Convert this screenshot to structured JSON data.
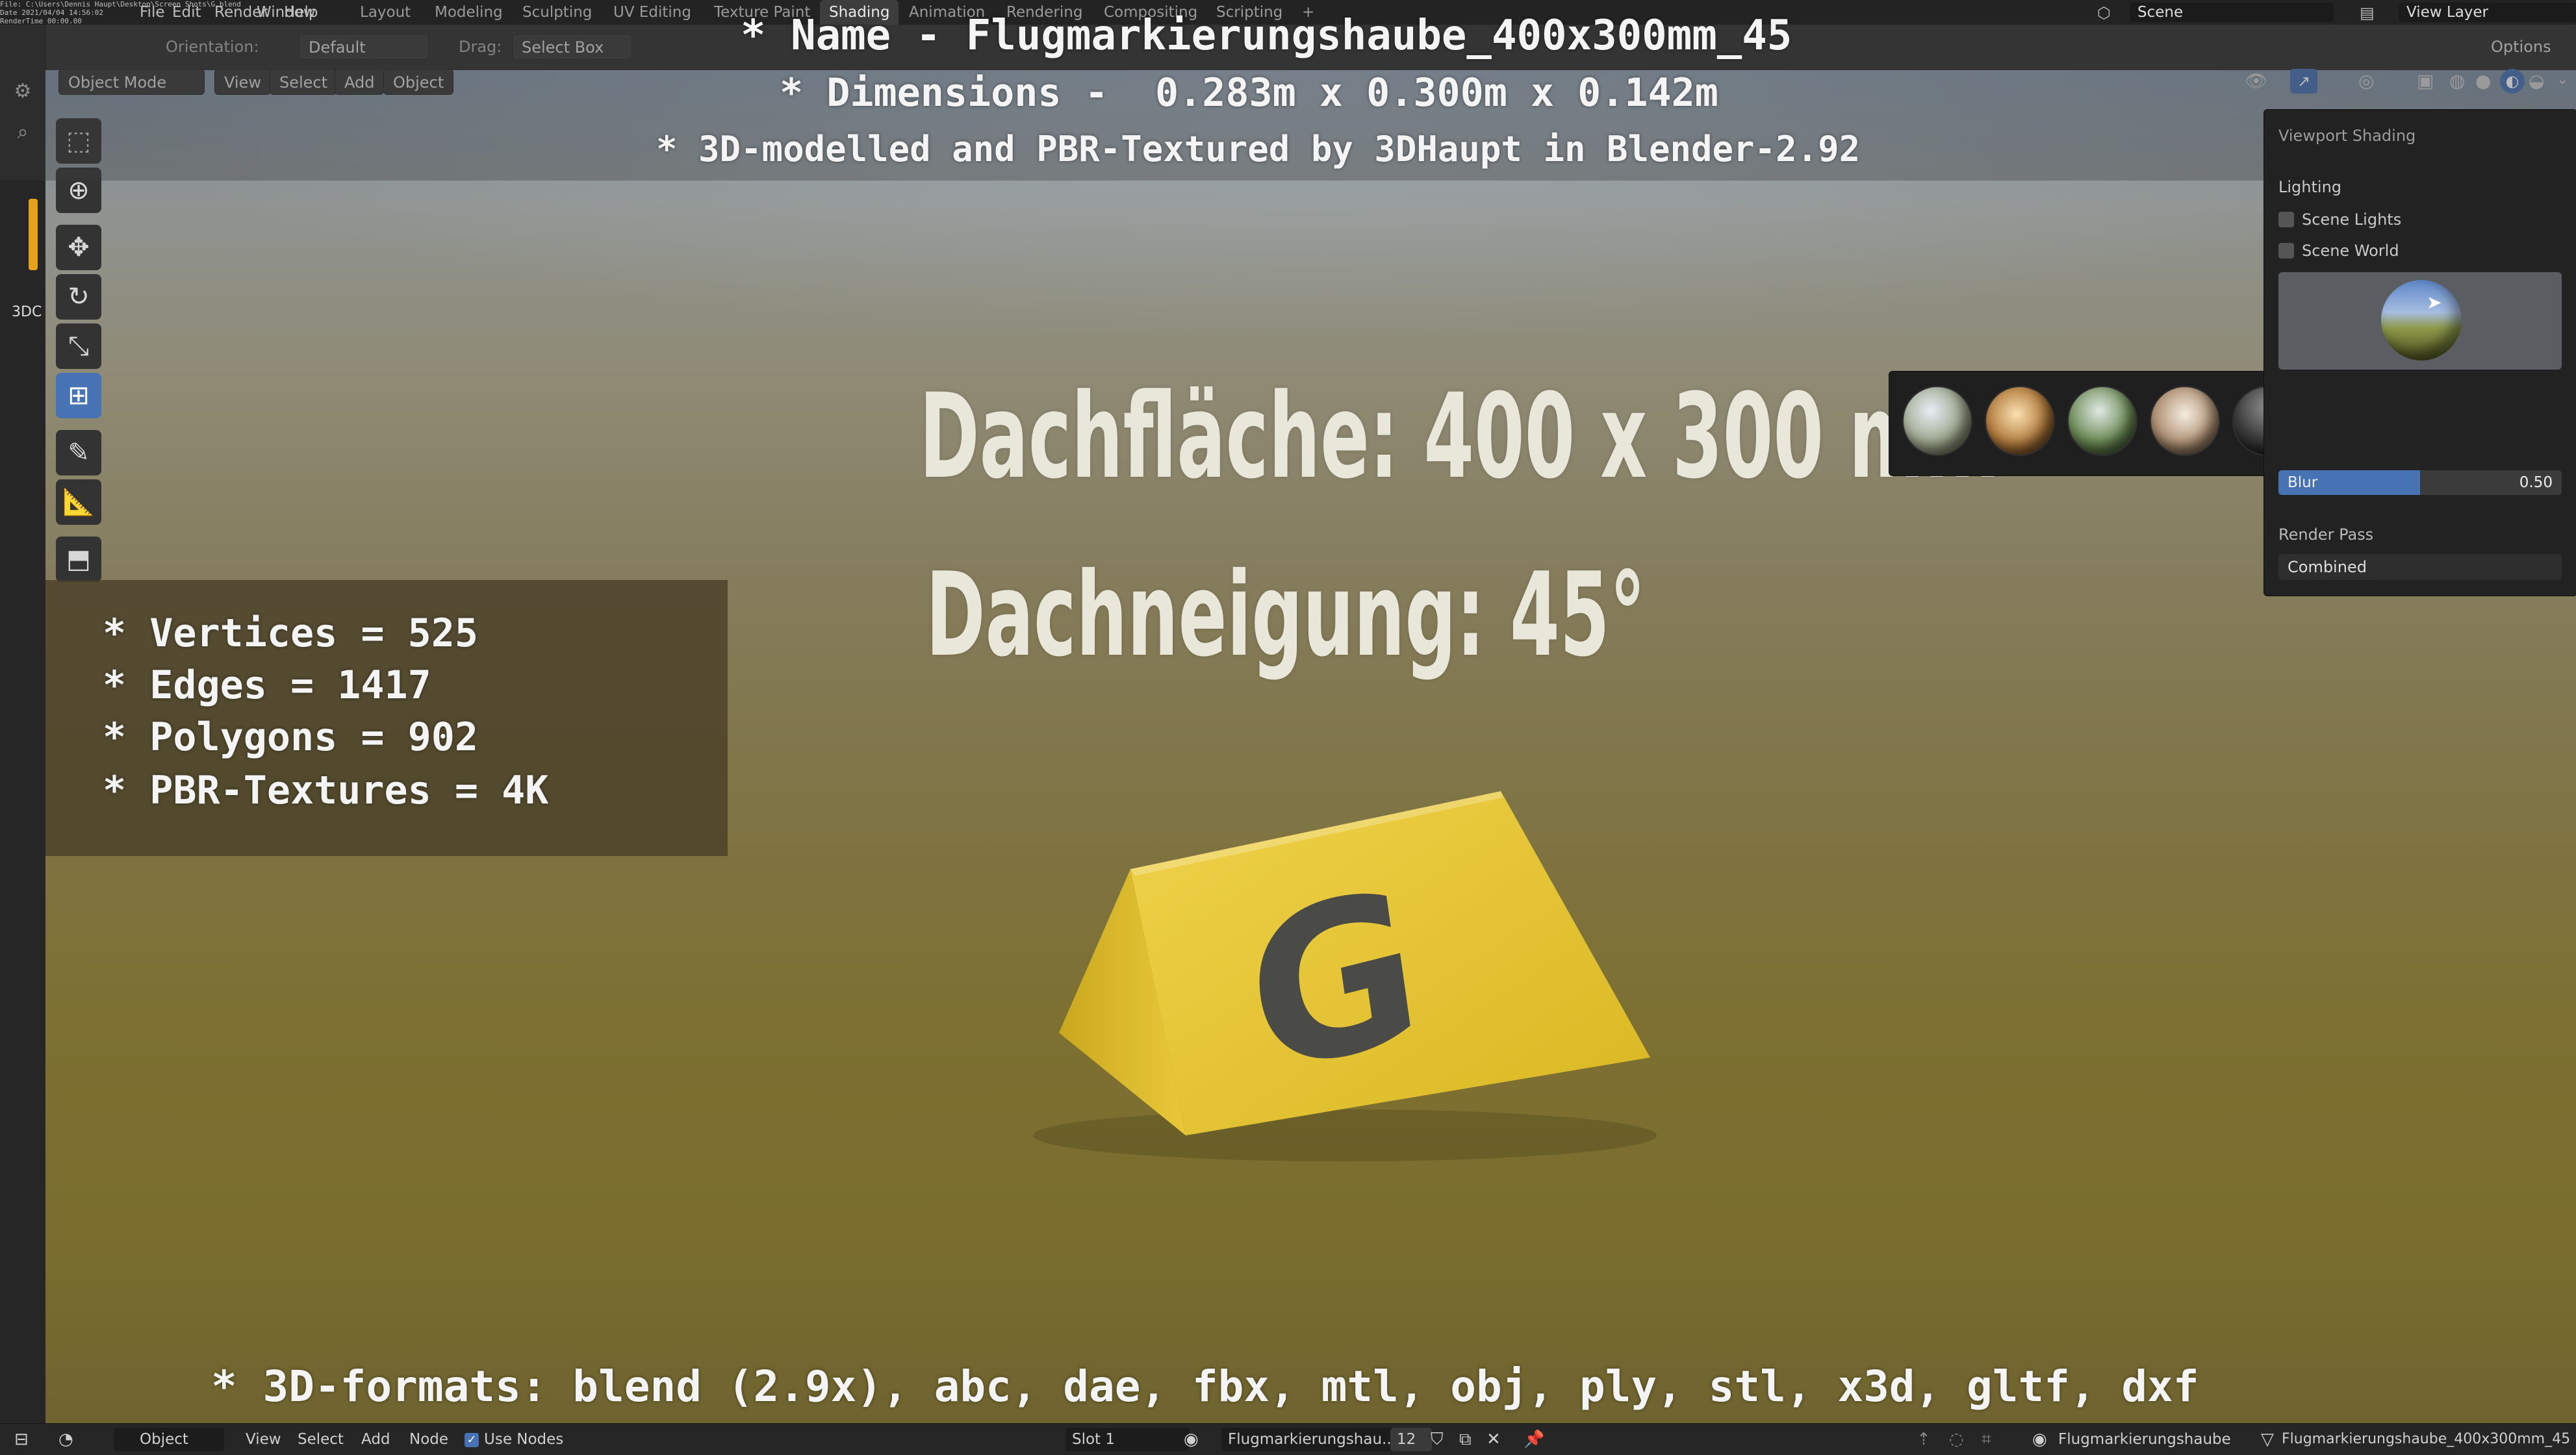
{
  "topbar": {
    "debug_lines": "File: C:\\Users\\Dennis Haupt\\Desktop\\Screen Shots\\G.blend\nDate 2021/04/04 14:56:02\nRenderTime 00:00.00\nModelled and Textured by 3DHaupt in Blender-2.92",
    "menu": [
      "File",
      "Edit",
      "Render",
      "Window",
      "Help"
    ],
    "workspaces": [
      "Layout",
      "Modeling",
      "Sculpting",
      "UV Editing",
      "Texture Paint",
      "Shading",
      "Animation",
      "Rendering",
      "Compositing",
      "Scripting"
    ],
    "active_workspace": "Shading",
    "add_tab": "+",
    "scene": "Scene",
    "view_layer": "View Layer"
  },
  "header": {
    "orientation_label": "Orientation:",
    "orientation_value": "Default",
    "drag_label": "Drag:",
    "drag_value": "Select Box",
    "options": "Options",
    "mode": "Object Mode",
    "menus": [
      "View",
      "Select",
      "Add",
      "Object"
    ]
  },
  "left_strip": {
    "label": "3DC"
  },
  "overlay": {
    "name_line": "* Name - Flugmarkierungshaube_400x300mm_45",
    "dimensions_line": "* Dimensions -  0.283m x 0.300m x 0.142m",
    "credit_line": "* 3D-modelled and PBR-Textured by 3DHaupt in Blender-2.92",
    "stats": [
      "* Vertices = 525",
      "* Edges = 1417",
      "* Polygons = 902",
      "* PBR-Textures = 4K"
    ],
    "formats_line": "* 3D-formats: blend (2.9x), abc, dae, fbx, mtl, obj, ply, stl, x3d, gltf, dxf"
  },
  "scene_labels": {
    "dachflaeche": "Dachfläche: 400 x 300 mm",
    "dachneigung": "Dachneigung: 45°",
    "marker_letter": "G"
  },
  "shading_panel": {
    "title": "Viewport Shading",
    "lighting": "Lighting",
    "scene_lights": "Scene Lights",
    "scene_world": "Scene World",
    "blur_label": "Blur",
    "blur_value": "0.50",
    "blur_fraction": 0.5,
    "render_pass_label": "Render Pass",
    "render_pass_value": "Combined"
  },
  "bottombar": {
    "editor_mode": "Object",
    "menus": [
      "View",
      "Select",
      "Add",
      "Node"
    ],
    "use_nodes": "Use Nodes",
    "slot": "Slot 1",
    "material": "Flugmarkierungshau...",
    "users": "12",
    "object_name": "Flugmarkierungshaube",
    "mesh_name": "Flugmarkierungshaube_400x300mm_45"
  },
  "colors": {
    "accent_blue": "#4772b3",
    "marker_yellow": "#e3c22a",
    "marker_letter": "#4a4a46",
    "active_tool": "#4772b3"
  }
}
